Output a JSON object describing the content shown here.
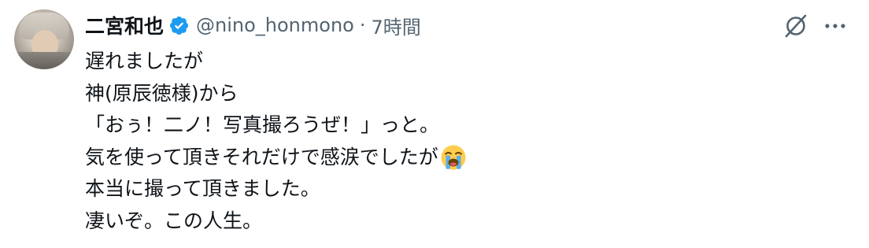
{
  "tweet": {
    "author_name": "二宮和也",
    "handle": "@nino_honmono",
    "separator": "·",
    "time": "7時間",
    "lines": [
      "遅れましたが",
      "神(原辰徳様)から",
      "「おぅ！二ノ！写真撮ろうぜ！」っと。",
      "気を使って頂きそれだけで感涙でしたが",
      "本当に撮って頂きました。",
      "凄いぞ。この人生。"
    ],
    "emoji": "loudly-crying-face-emoji",
    "icons": {
      "verified": "verified-badge-icon",
      "grok": "grok-icon",
      "more": "more-icon"
    }
  },
  "colors": {
    "text": "#0f1419",
    "secondary": "#536471",
    "verified": "#1d9bf0",
    "background": "#ffffff"
  }
}
